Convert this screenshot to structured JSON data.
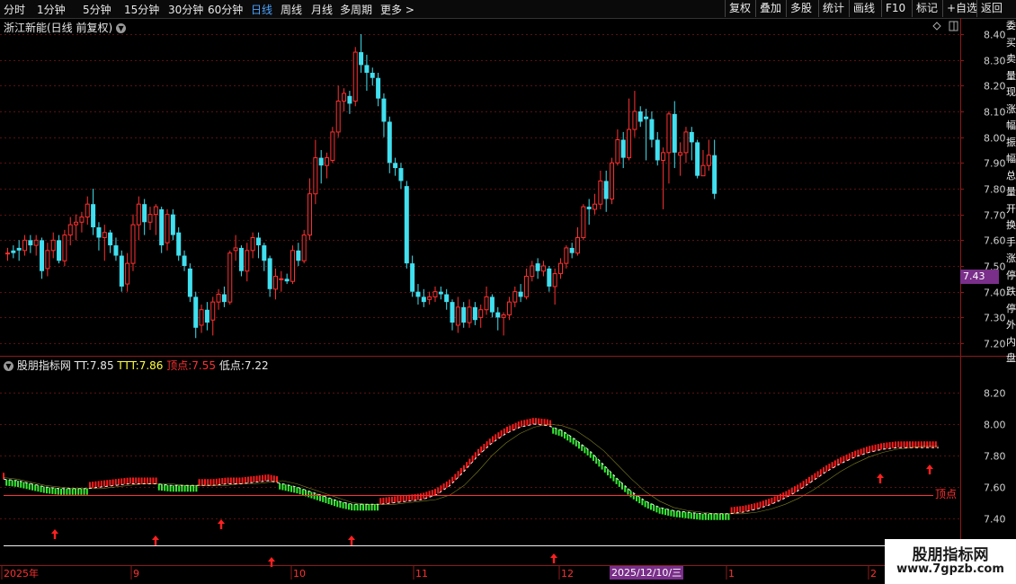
{
  "toolbar": {
    "periods": [
      "分时",
      "1分钟",
      "5分钟",
      "15分钟",
      "30分钟",
      "60分钟",
      "日线",
      "周线",
      "月线",
      "多周期",
      "更多 >"
    ],
    "active_period": "日线",
    "right_buttons": [
      "复权",
      "叠加",
      "多股",
      "统计",
      "画线",
      "F10",
      "标记",
      "+自选",
      "返回"
    ]
  },
  "main_chart": {
    "title": "浙江新能(日线 前复权)",
    "current_price": "7.43",
    "price_axis": [
      "8.40",
      "8.30",
      "8.20",
      "8.10",
      "8.00",
      "7.90",
      "7.80",
      "7.70",
      "7.60",
      "7.50",
      "7.40",
      "7.30",
      "7.20"
    ]
  },
  "indicator_chart": {
    "name": "股朋指标网",
    "tt_label": "TT:",
    "tt_value": "7.85",
    "ttt_label": "TTT:",
    "ttt_value": "7.86",
    "top_label": "顶点:",
    "top_value": "7.55",
    "low_label": "低点:",
    "low_value": "7.22",
    "axis": [
      "8.20",
      "8.00",
      "7.80",
      "7.60",
      "7.40"
    ],
    "top_line_label": "顶点"
  },
  "time_axis": {
    "labels": [
      "2025年",
      "9",
      "10",
      "11",
      "12",
      "1",
      "2"
    ],
    "selected_date": "2025/12/10/三"
  },
  "side_strip_text": "委买卖量现涨幅振幅总量开换手涨停跌停外内盘",
  "watermark": {
    "title": "股朋指标网",
    "url": "www.7gpzb.com"
  },
  "colors": {
    "up": "#ff3030",
    "down": "#40e0f0",
    "bull_fill": "#ff1a1a",
    "bear_fill": "#33ee33",
    "tag": "#7a2f8a"
  },
  "chart_data": [
    {
      "type": "candlestick",
      "title": "浙江新能(日线 前复权)",
      "ylim": [
        7.18,
        8.43
      ],
      "candles": [
        [
          7.55,
          7.55,
          7.57,
          7.52
        ],
        [
          7.56,
          7.55,
          7.58,
          7.53
        ],
        [
          7.57,
          7.56,
          7.6,
          7.52
        ],
        [
          7.56,
          7.6,
          7.62,
          7.54
        ],
        [
          7.6,
          7.58,
          7.62,
          7.55
        ],
        [
          7.58,
          7.6,
          7.62,
          7.54
        ],
        [
          7.6,
          7.48,
          7.61,
          7.45
        ],
        [
          7.49,
          7.56,
          7.59,
          7.46
        ],
        [
          7.56,
          7.6,
          7.63,
          7.53
        ],
        [
          7.6,
          7.52,
          7.62,
          7.51
        ],
        [
          7.52,
          7.62,
          7.64,
          7.5
        ],
        [
          7.62,
          7.66,
          7.69,
          7.58
        ],
        [
          7.66,
          7.67,
          7.7,
          7.6
        ],
        [
          7.67,
          7.69,
          7.71,
          7.63
        ],
        [
          7.69,
          7.74,
          7.77,
          7.66
        ],
        [
          7.74,
          7.65,
          7.8,
          7.62
        ],
        [
          7.65,
          7.61,
          7.67,
          7.56
        ],
        [
          7.61,
          7.63,
          7.66,
          7.52
        ],
        [
          7.63,
          7.58,
          7.64,
          7.55
        ],
        [
          7.58,
          7.54,
          7.61,
          7.52
        ],
        [
          7.54,
          7.42,
          7.56,
          7.4
        ],
        [
          7.43,
          7.51,
          7.55,
          7.4
        ],
        [
          7.51,
          7.66,
          7.7,
          7.48
        ],
        [
          7.66,
          7.74,
          7.77,
          7.6
        ],
        [
          7.74,
          7.67,
          7.76,
          7.62
        ],
        [
          7.67,
          7.7,
          7.73,
          7.64
        ],
        [
          7.7,
          7.73,
          7.74,
          7.62
        ],
        [
          7.72,
          7.58,
          7.73,
          7.55
        ],
        [
          7.59,
          7.7,
          7.72,
          7.56
        ],
        [
          7.7,
          7.62,
          7.72,
          7.6
        ],
        [
          7.63,
          7.54,
          7.65,
          7.52
        ],
        [
          7.54,
          7.5,
          7.56,
          7.48
        ],
        [
          7.49,
          7.38,
          7.51,
          7.36
        ],
        [
          7.38,
          7.26,
          7.4,
          7.22
        ],
        [
          7.27,
          7.33,
          7.35,
          7.24
        ],
        [
          7.33,
          7.28,
          7.36,
          7.25
        ],
        [
          7.29,
          7.36,
          7.38,
          7.23
        ],
        [
          7.36,
          7.39,
          7.41,
          7.33
        ],
        [
          7.39,
          7.36,
          7.42,
          7.34
        ],
        [
          7.36,
          7.55,
          7.56,
          7.35
        ],
        [
          7.56,
          7.57,
          7.62,
          7.52
        ],
        [
          7.57,
          7.48,
          7.58,
          7.46
        ],
        [
          7.48,
          7.56,
          7.59,
          7.44
        ],
        [
          7.56,
          7.61,
          7.63,
          7.53
        ],
        [
          7.61,
          7.58,
          7.63,
          7.53
        ],
        [
          7.58,
          7.52,
          7.59,
          7.48
        ],
        [
          7.53,
          7.41,
          7.54,
          7.38
        ],
        [
          7.41,
          7.46,
          7.49,
          7.37
        ],
        [
          7.45,
          7.45,
          7.48,
          7.4
        ],
        [
          7.45,
          7.44,
          7.47,
          7.43
        ],
        [
          7.44,
          7.56,
          7.58,
          7.43
        ],
        [
          7.56,
          7.52,
          7.59,
          7.5
        ],
        [
          7.52,
          7.62,
          7.64,
          7.51
        ],
        [
          7.62,
          7.78,
          7.84,
          7.6
        ],
        [
          7.78,
          7.92,
          7.99,
          7.74
        ],
        [
          7.92,
          7.89,
          7.95,
          7.82
        ],
        [
          7.89,
          7.92,
          7.94,
          7.84
        ],
        [
          7.91,
          8.02,
          8.04,
          7.9
        ],
        [
          8.02,
          8.14,
          8.2,
          8.0
        ],
        [
          8.14,
          8.17,
          8.19,
          8.1
        ],
        [
          8.16,
          8.13,
          8.18,
          8.09
        ],
        [
          8.14,
          8.33,
          8.35,
          8.12
        ],
        [
          8.33,
          8.28,
          8.4,
          8.25
        ],
        [
          8.28,
          8.25,
          8.32,
          8.18
        ],
        [
          8.25,
          8.23,
          8.27,
          8.2
        ],
        [
          8.23,
          8.15,
          8.25,
          8.12
        ],
        [
          8.15,
          8.06,
          8.17,
          8.0
        ],
        [
          8.06,
          7.9,
          8.08,
          7.86
        ],
        [
          7.9,
          7.88,
          7.92,
          7.85
        ],
        [
          7.88,
          7.83,
          7.9,
          7.8
        ],
        [
          7.81,
          7.51,
          7.83,
          7.49
        ],
        [
          7.51,
          7.4,
          7.54,
          7.38
        ],
        [
          7.4,
          7.38,
          7.43,
          7.35
        ],
        [
          7.38,
          7.36,
          7.41,
          7.34
        ],
        [
          7.37,
          7.38,
          7.4,
          7.35
        ],
        [
          7.38,
          7.4,
          7.42,
          7.36
        ],
        [
          7.4,
          7.39,
          7.42,
          7.37
        ],
        [
          7.39,
          7.36,
          7.41,
          7.33
        ],
        [
          7.36,
          7.28,
          7.37,
          7.25
        ],
        [
          7.27,
          7.34,
          7.38,
          7.24
        ],
        [
          7.34,
          7.28,
          7.36,
          7.26
        ],
        [
          7.28,
          7.34,
          7.37,
          7.26
        ],
        [
          7.34,
          7.29,
          7.36,
          7.27
        ],
        [
          7.3,
          7.33,
          7.35,
          7.26
        ],
        [
          7.33,
          7.38,
          7.42,
          7.31
        ],
        [
          7.38,
          7.32,
          7.39,
          7.3
        ],
        [
          7.32,
          7.3,
          7.34,
          7.25
        ],
        [
          7.3,
          7.31,
          7.32,
          7.23
        ],
        [
          7.31,
          7.36,
          7.38,
          7.29
        ],
        [
          7.36,
          7.4,
          7.42,
          7.34
        ],
        [
          7.4,
          7.38,
          7.43,
          7.36
        ],
        [
          7.38,
          7.46,
          7.49,
          7.37
        ],
        [
          7.46,
          7.5,
          7.52,
          7.44
        ],
        [
          7.51,
          7.48,
          7.53,
          7.45
        ],
        [
          7.48,
          7.5,
          7.52,
          7.46
        ],
        [
          7.49,
          7.42,
          7.5,
          7.4
        ],
        [
          7.42,
          7.47,
          7.49,
          7.35
        ],
        [
          7.47,
          7.51,
          7.53,
          7.45
        ],
        [
          7.51,
          7.57,
          7.58,
          7.49
        ],
        [
          7.57,
          7.55,
          7.59,
          7.53
        ],
        [
          7.55,
          7.61,
          7.65,
          7.54
        ],
        [
          7.61,
          7.73,
          7.74,
          7.6
        ],
        [
          7.73,
          7.72,
          7.76,
          7.66
        ],
        [
          7.72,
          7.74,
          7.78,
          7.7
        ],
        [
          7.74,
          7.83,
          7.87,
          7.72
        ],
        [
          7.83,
          7.76,
          7.87,
          7.71
        ],
        [
          7.76,
          7.9,
          7.92,
          7.74
        ],
        [
          7.9,
          7.99,
          8.03,
          7.89
        ],
        [
          7.99,
          7.92,
          8.02,
          7.88
        ],
        [
          7.92,
          8.03,
          8.15,
          7.91
        ],
        [
          8.03,
          8.1,
          8.18,
          8.0
        ],
        [
          8.1,
          8.06,
          8.12,
          8.04
        ],
        [
          8.08,
          8.07,
          8.11,
          7.91
        ],
        [
          8.07,
          7.99,
          8.1,
          7.96
        ],
        [
          7.99,
          7.91,
          8.02,
          7.89
        ],
        [
          7.91,
          7.94,
          7.96,
          7.72
        ],
        [
          7.94,
          8.09,
          8.1,
          7.82
        ],
        [
          8.09,
          7.94,
          8.14,
          7.88
        ],
        [
          7.93,
          7.94,
          7.98,
          7.85
        ],
        [
          7.94,
          8.02,
          8.04,
          7.9
        ],
        [
          8.02,
          7.98,
          8.04,
          7.91
        ],
        [
          7.98,
          7.85,
          7.99,
          7.84
        ],
        [
          7.85,
          7.89,
          7.95,
          7.85
        ],
        [
          7.89,
          7.93,
          7.99,
          7.87
        ],
        [
          7.93,
          7.78,
          7.99,
          7.76
        ]
      ],
      "current_price": 7.43
    },
    {
      "type": "area",
      "title": "股朋指标网",
      "ylim": [
        7.32,
        8.32
      ],
      "series": [
        {
          "name": "TT",
          "values": [
            7.65,
            7.64,
            7.62,
            7.6,
            7.59,
            7.59,
            7.59,
            7.6,
            7.61,
            7.62,
            7.62,
            7.62,
            7.61,
            7.61,
            7.61,
            7.61,
            7.62,
            7.62,
            7.63,
            7.64,
            7.62,
            7.6,
            7.57,
            7.54,
            7.51,
            7.49,
            7.49,
            7.49,
            7.5,
            7.51,
            7.52,
            7.55,
            7.61,
            7.7,
            7.8,
            7.88,
            7.94,
            7.98,
            8.0,
            7.99,
            7.96,
            7.9,
            7.83,
            7.74,
            7.65,
            7.57,
            7.51,
            7.47,
            7.45,
            7.44,
            7.43,
            7.43,
            7.43,
            7.44,
            7.46,
            7.49,
            7.53,
            7.58,
            7.64,
            7.7,
            7.75,
            7.79,
            7.82,
            7.84,
            7.85,
            7.85,
            7.85,
            7.85
          ]
        },
        {
          "name": "TTT",
          "values": [
            7.66,
            7.65,
            7.63,
            7.61,
            7.6,
            7.59,
            7.59,
            7.59,
            7.6,
            7.61,
            7.62,
            7.62,
            7.62,
            7.61,
            7.61,
            7.61,
            7.61,
            7.62,
            7.62,
            7.63,
            7.64,
            7.62,
            7.59,
            7.56,
            7.53,
            7.5,
            7.49,
            7.49,
            7.49,
            7.5,
            7.51,
            7.52,
            7.55,
            7.61,
            7.7,
            7.8,
            7.88,
            7.94,
            7.98,
            8.0,
            7.99,
            7.96,
            7.9,
            7.83,
            7.74,
            7.65,
            7.57,
            7.51,
            7.47,
            7.45,
            7.44,
            7.43,
            7.43,
            7.43,
            7.44,
            7.46,
            7.49,
            7.53,
            7.58,
            7.64,
            7.7,
            7.75,
            7.79,
            7.82,
            7.84,
            7.85,
            7.86,
            7.86
          ]
        },
        {
          "name": "顶点",
          "values": [
            7.55
          ]
        },
        {
          "name": "低点",
          "values": [
            7.22
          ]
        }
      ]
    }
  ]
}
